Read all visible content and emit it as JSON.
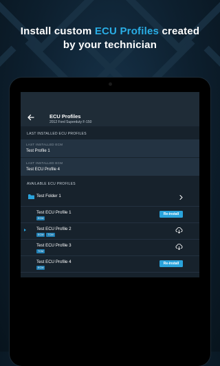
{
  "headline": {
    "line1_pre": "Install custom ",
    "line1_accent": "ECU Profiles",
    "line1_post": " created",
    "line2": "by your technician"
  },
  "appbar": {
    "title": "ECU Profiles",
    "subtitle": "2012 Ford Superduty F-150",
    "back_icon": "arrow-left-icon"
  },
  "last_installed": {
    "section_label": "LAST INSTALLED ECU PROFILES",
    "items": [
      {
        "key": "LAST INSTALLED ECM",
        "value": "Test Profile 1"
      },
      {
        "key": "LAST INSTALLED ECM",
        "value": "Test ECU Profile 4"
      }
    ]
  },
  "available": {
    "section_label": "AVAILABLE ECU PROFILES",
    "folder": {
      "label": "Test Folder 1",
      "icon": "folder-icon",
      "chevron": "chevron-right-icon"
    },
    "profiles": [
      {
        "name": "Test ECU Profile 1",
        "tags": [
          "ECM"
        ],
        "action": "Re-install"
      },
      {
        "name": "Test ECU Profile 2",
        "tags": [
          "ECM",
          "TCM"
        ],
        "action": "download-icon"
      },
      {
        "name": "Test ECU Profile 3",
        "tags": [
          "TCM"
        ],
        "action": "download-icon"
      },
      {
        "name": "Test ECU Profile 4",
        "tags": [
          "ECM"
        ],
        "action": "Re-install"
      }
    ]
  },
  "colors": {
    "accent": "#2aaee6",
    "button": "#2aa3db",
    "tag": "#1f7fb4",
    "screen_bg": "#17222c",
    "card_bg": "#233342"
  }
}
